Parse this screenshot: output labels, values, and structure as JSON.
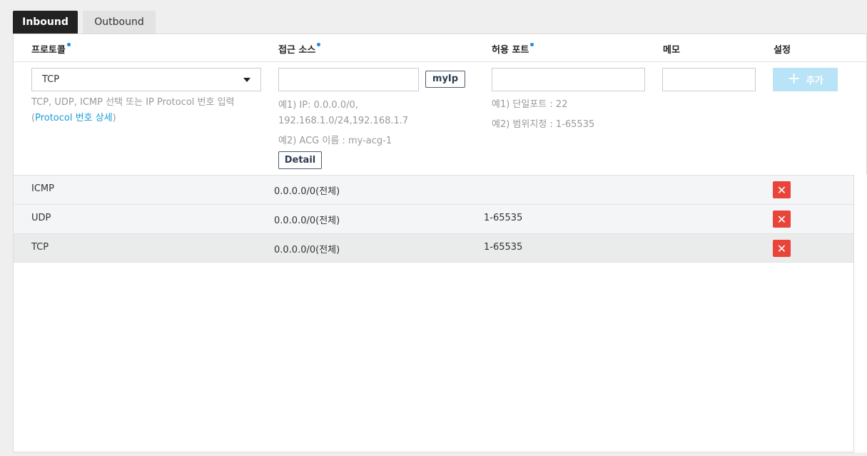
{
  "tabs": {
    "inbound": "Inbound",
    "outbound": "Outbound"
  },
  "headers": {
    "protocol": "프로토콜",
    "source": "접근 소스",
    "port": "허용 포트",
    "memo": "메모",
    "settings": "설정"
  },
  "form": {
    "protocol_value": "TCP",
    "protocol_help": "TCP, UDP, ICMP 선택 또는 IP Protocol 번호 입력",
    "protocol_link_open": "(",
    "protocol_link": "Protocol 번호 상세",
    "protocol_link_close": ")",
    "source_value": "",
    "myip_label": "myIp",
    "source_help1_line1": "예1) IP: 0.0.0.0/0,",
    "source_help1_line2": "192.168.1.0/24,192.168.1.7",
    "source_help2": "예2) ACG 이름 : my-acg-1",
    "detail_label": "Detail",
    "port_value": "",
    "port_help1": "예1) 단일포트 : 22",
    "port_help2": "예2) 범위지정 : 1-65535",
    "memo_value": "",
    "add_label": "추가"
  },
  "rules": [
    {
      "protocol": "ICMP",
      "source": "0.0.0.0/0(전체)",
      "port": ""
    },
    {
      "protocol": "UDP",
      "source": "0.0.0.0/0(전체)",
      "port": "1-65535"
    },
    {
      "protocol": "TCP",
      "source": "0.0.0.0/0(전체)",
      "port": "1-65535"
    }
  ],
  "colors": {
    "accent": "#1e88e5",
    "link": "#1a9bd7",
    "delete": "#e8443a",
    "add_disabled": "#b9e4f7"
  }
}
